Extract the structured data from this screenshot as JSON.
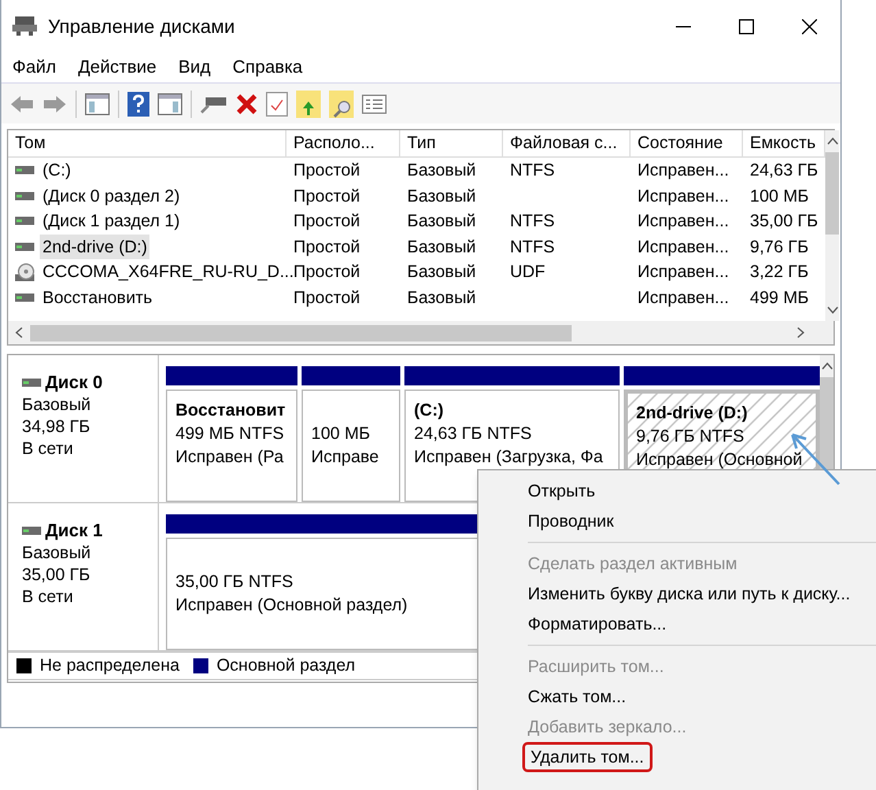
{
  "window": {
    "title": "Управление дисками"
  },
  "menu": [
    "Файл",
    "Действие",
    "Вид",
    "Справка"
  ],
  "volumes_table": {
    "columns": [
      "Том",
      "Располо...",
      "Тип",
      "Файловая с...",
      "Состояние",
      "Емкость"
    ],
    "rows": [
      {
        "kind": "disk",
        "selected": false,
        "cells": [
          "(C:)",
          "Простой",
          "Базовый",
          "NTFS",
          "Исправен...",
          "24,63 ГБ"
        ]
      },
      {
        "kind": "disk",
        "selected": false,
        "cells": [
          "(Диск 0 раздел 2)",
          "Простой",
          "Базовый",
          "",
          "Исправен...",
          "100 МБ"
        ]
      },
      {
        "kind": "disk",
        "selected": false,
        "cells": [
          "(Диск 1 раздел 1)",
          "Простой",
          "Базовый",
          "NTFS",
          "Исправен...",
          "35,00 ГБ"
        ]
      },
      {
        "kind": "disk",
        "selected": true,
        "cells": [
          "2nd-drive (D:)",
          "Простой",
          "Базовый",
          "NTFS",
          "Исправен...",
          "9,76 ГБ"
        ]
      },
      {
        "kind": "cd",
        "selected": false,
        "cells": [
          "CCCOMA_X64FRE_RU-RU_D...",
          "Простой",
          "Базовый",
          "UDF",
          "Исправен...",
          "3,22 ГБ"
        ]
      },
      {
        "kind": "disk",
        "selected": false,
        "cells": [
          "Восстановить",
          "Простой",
          "Базовый",
          "",
          "Исправен...",
          "499 МБ"
        ]
      }
    ]
  },
  "disks": [
    {
      "name": "Диск 0",
      "type": "Базовый",
      "size": "34,98 ГБ",
      "status": "В сети",
      "partitions": [
        {
          "label": "Восстановит",
          "size": "499 МБ NTFS",
          "status": "Исправен (Ра",
          "selected": false
        },
        {
          "size": "100 МБ",
          "status": "Исправе",
          "selected": false
        },
        {
          "label": "(C:)",
          "size": "24,63 ГБ NTFS",
          "status": "Исправен (Загрузка, Фа",
          "selected": false
        },
        {
          "label": "2nd-drive  (D:)",
          "size": "9,76 ГБ NTFS",
          "status": "Исправен (Основной",
          "selected": true
        }
      ]
    },
    {
      "name": "Диск 1",
      "type": "Базовый",
      "size": "35,00 ГБ",
      "status": "В сети",
      "partitions": [
        {
          "size": "35,00 ГБ NTFS",
          "status": "Исправен (Основной раздел)",
          "selected": false
        }
      ]
    }
  ],
  "legend": [
    {
      "label": "Не распределена",
      "color": "#000000"
    },
    {
      "label": "Основной раздел",
      "color": "#000080"
    }
  ],
  "context_menu": [
    {
      "label": "Открыть",
      "disabled": false,
      "separator_before": false,
      "highlighted": false
    },
    {
      "label": "Проводник",
      "disabled": false,
      "separator_before": false,
      "highlighted": false
    },
    {
      "label": "Сделать раздел активным",
      "disabled": true,
      "separator_before": true,
      "highlighted": false
    },
    {
      "label": "Изменить букву диска или путь к диску...",
      "disabled": false,
      "separator_before": false,
      "highlighted": false
    },
    {
      "label": "Форматировать...",
      "disabled": false,
      "separator_before": false,
      "highlighted": false
    },
    {
      "label": "Расширить том...",
      "disabled": true,
      "separator_before": true,
      "highlighted": false
    },
    {
      "label": "Сжать том...",
      "disabled": false,
      "separator_before": false,
      "highlighted": false
    },
    {
      "label": "Добавить зеркало...",
      "disabled": true,
      "separator_before": false,
      "highlighted": false
    },
    {
      "label": "Удалить том...",
      "disabled": false,
      "separator_before": false,
      "highlighted": true
    }
  ]
}
